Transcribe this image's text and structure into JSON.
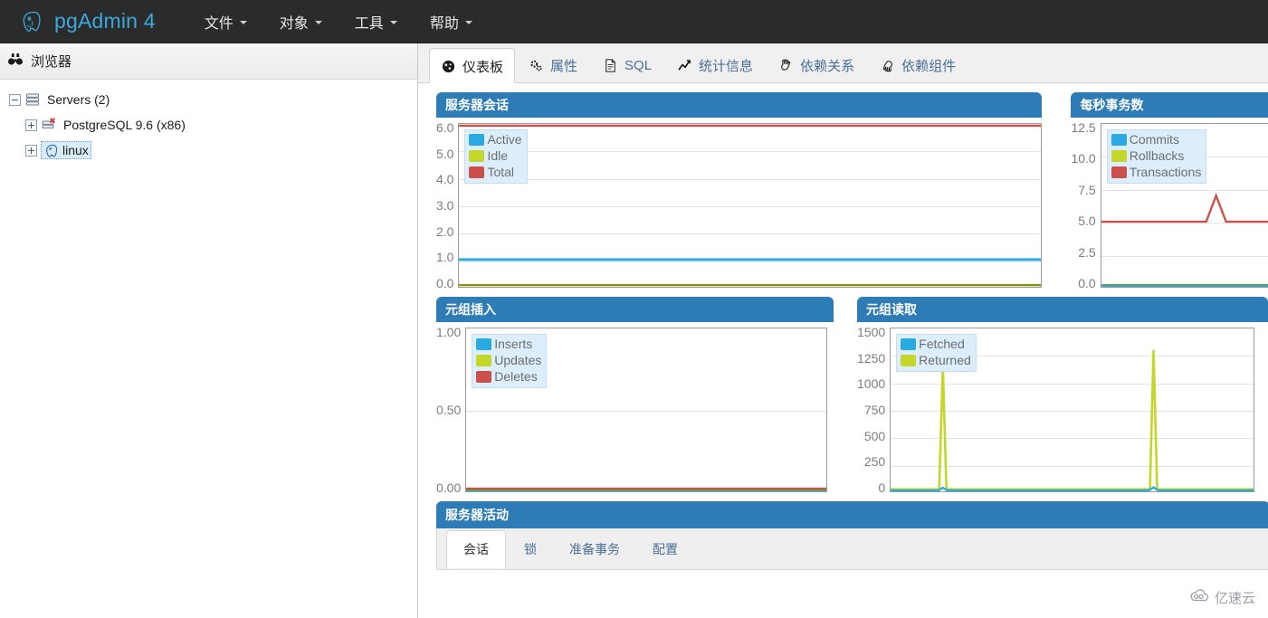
{
  "app": {
    "title": "pgAdmin 4",
    "logo_icon": "postgres-elephant-icon",
    "accent": "#3ba9dd",
    "navbar_bg": "#2b2b2b"
  },
  "menu": [
    {
      "label": "文件",
      "icon": "chevron-down-icon"
    },
    {
      "label": "对象",
      "icon": "chevron-down-icon"
    },
    {
      "label": "工具",
      "icon": "chevron-down-icon"
    },
    {
      "label": "帮助",
      "icon": "chevron-down-icon"
    }
  ],
  "browser": {
    "title": "浏览器",
    "title_icon": "binoculars-icon",
    "tree": [
      {
        "label": "Servers (2)",
        "icon": "servers-icon",
        "level": 0,
        "expanded": true,
        "selected": false
      },
      {
        "label": "PostgreSQL 9.6 (x86)",
        "icon": "server-disconnected-icon",
        "level": 1,
        "expanded": false,
        "selected": false
      },
      {
        "label": "linux",
        "icon": "postgres-elephant-icon",
        "level": 1,
        "expanded": false,
        "selected": true
      }
    ]
  },
  "tabs": [
    {
      "label": "仪表板",
      "icon": "dashboard-gauge-icon",
      "active": true
    },
    {
      "label": "属性",
      "icon": "properties-gears-icon",
      "active": false
    },
    {
      "label": "SQL",
      "icon": "sql-document-icon",
      "active": false
    },
    {
      "label": "统计信息",
      "icon": "statistics-chart-icon",
      "active": false
    },
    {
      "label": "依赖关系",
      "icon": "dependencies-hand-icon",
      "active": false
    },
    {
      "label": "依赖组件",
      "icon": "dependents-hand-icon",
      "active": false
    }
  ],
  "colors": {
    "panel_header": "#2e7cb6",
    "series_blue": "#29abe2",
    "series_green": "#c3d62a",
    "series_red": "#cb4f4b",
    "legend_bg": "#dceefb",
    "axis_text": "#7d7d7d"
  },
  "activity": {
    "title": "服务器活动",
    "tabs": [
      {
        "label": "会话",
        "active": true
      },
      {
        "label": "锁",
        "active": false
      },
      {
        "label": "准备事务",
        "active": false
      },
      {
        "label": "配置",
        "active": false
      }
    ]
  },
  "watermark": {
    "text": "亿速云",
    "icon": "cloud-logo-icon"
  },
  "chart_data": [
    {
      "id": "server-sessions",
      "type": "line",
      "title": "服务器会话",
      "xlabel": "",
      "ylabel": "",
      "ylim": [
        0.0,
        6.0
      ],
      "yticks": [
        "6.0",
        "5.0",
        "4.0",
        "3.0",
        "2.0",
        "1.0",
        "0.0"
      ],
      "grid": true,
      "legend_position": "top-left",
      "series": [
        {
          "name": "Active",
          "color": "#29abe2",
          "constant": 1.0,
          "values": [
            1,
            1,
            1,
            1,
            1,
            1,
            1,
            1,
            1,
            1,
            1,
            1,
            1,
            1,
            1,
            1,
            1,
            1,
            1,
            1
          ]
        },
        {
          "name": "Idle",
          "color": "#c3d62a",
          "constant": 0.0,
          "values": [
            0,
            0,
            0,
            0,
            0,
            0,
            0,
            0,
            0,
            0,
            0,
            0,
            0,
            0,
            0,
            0,
            0,
            0,
            0,
            0
          ]
        },
        {
          "name": "Total",
          "color": "#cb4f4b",
          "constant": 6.0,
          "values": [
            6,
            6,
            6,
            6,
            6,
            6,
            6,
            6,
            6,
            6,
            6,
            6,
            6,
            6,
            6,
            6,
            6,
            6,
            6,
            6
          ]
        }
      ]
    },
    {
      "id": "transactions-per-second",
      "type": "line",
      "title": "每秒事务数",
      "xlabel": "",
      "ylabel": "",
      "ylim": [
        0.0,
        12.5
      ],
      "yticks": [
        "12.5",
        "10.0",
        "7.5",
        "5.0",
        "2.5",
        "0.0"
      ],
      "grid": true,
      "legend_position": "top-left",
      "series": [
        {
          "name": "Commits",
          "color": "#29abe2",
          "constant": 0.0,
          "values": [
            0,
            0,
            0,
            0,
            0,
            0,
            0,
            0,
            0,
            0,
            0,
            0,
            0,
            0,
            0,
            0,
            0,
            0,
            0,
            0
          ]
        },
        {
          "name": "Rollbacks",
          "color": "#c3d62a",
          "constant": 0.0,
          "values": [
            0,
            0,
            0,
            0,
            0,
            0,
            0,
            0,
            0,
            0,
            0,
            0,
            0,
            0,
            0,
            0,
            0,
            0,
            0,
            0
          ]
        },
        {
          "name": "Transactions",
          "color": "#cb4f4b",
          "constant": 5.0,
          "values": [
            5,
            5,
            5,
            5,
            5,
            5,
            5,
            5,
            5,
            5,
            5,
            7,
            5,
            5,
            5,
            5,
            5,
            5,
            5,
            5
          ]
        }
      ]
    },
    {
      "id": "tuples-in",
      "type": "line",
      "title": "元组插入",
      "xlabel": "",
      "ylabel": "",
      "ylim": [
        0.0,
        1.0
      ],
      "yticks": [
        "1.00",
        "0.50",
        "0.00"
      ],
      "grid": true,
      "legend_position": "top-left",
      "series": [
        {
          "name": "Inserts",
          "color": "#29abe2",
          "constant": 0.0,
          "values": [
            0,
            0,
            0,
            0,
            0,
            0,
            0,
            0,
            0,
            0,
            0,
            0,
            0,
            0,
            0,
            0,
            0,
            0,
            0,
            0
          ]
        },
        {
          "name": "Updates",
          "color": "#c3d62a",
          "constant": 0.0,
          "values": [
            0,
            0,
            0,
            0,
            0,
            0,
            0,
            0,
            0,
            0,
            0,
            0,
            0,
            0,
            0,
            0,
            0,
            0,
            0,
            0
          ]
        },
        {
          "name": "Deletes",
          "color": "#cb4f4b",
          "constant": 0.0,
          "values": [
            0,
            0,
            0,
            0,
            0,
            0,
            0,
            0,
            0,
            0,
            0,
            0,
            0,
            0,
            0,
            0,
            0,
            0,
            0,
            0
          ]
        }
      ]
    },
    {
      "id": "tuples-out",
      "type": "line",
      "title": "元组读取",
      "xlabel": "",
      "ylabel": "",
      "ylim": [
        0,
        1500
      ],
      "yticks": [
        "1500",
        "1250",
        "1000",
        "750",
        "500",
        "250",
        "0"
      ],
      "grid": true,
      "legend_position": "top-left",
      "series": [
        {
          "name": "Fetched",
          "color": "#29abe2",
          "constant": 0,
          "values": [
            0,
            0,
            0,
            0,
            0,
            0,
            25,
            0,
            0,
            0,
            0,
            0,
            0,
            0,
            0,
            0,
            0,
            30,
            0,
            0
          ]
        },
        {
          "name": "Returned",
          "color": "#c3d62a",
          "constant": 20,
          "values": [
            20,
            20,
            20,
            20,
            20,
            20,
            1150,
            20,
            20,
            20,
            20,
            20,
            20,
            20,
            20,
            20,
            20,
            1300,
            20,
            20
          ]
        }
      ]
    }
  ]
}
